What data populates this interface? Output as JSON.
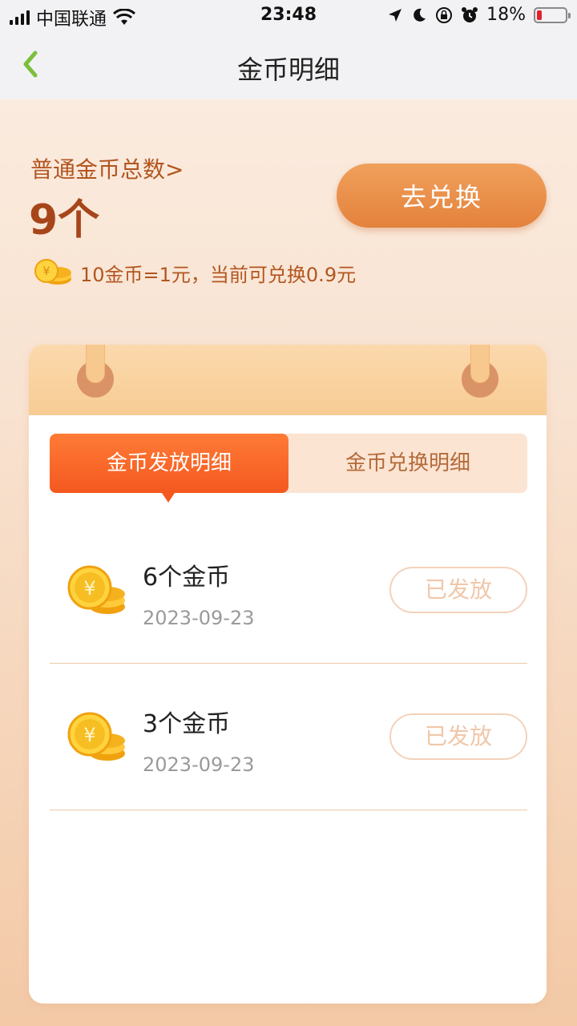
{
  "status_bar": {
    "carrier": "中国联通",
    "time": "23:48",
    "battery": "18%",
    "battery_level": 0.18
  },
  "nav": {
    "title": "金币明细"
  },
  "summary": {
    "total_label": "普通金币总数>",
    "total_value": "9个",
    "exchange_button": "去兑换",
    "rate_text": "10金币=1元，当前可兑换0.9元"
  },
  "tabs": [
    {
      "label": "金币发放明细",
      "active": true
    },
    {
      "label": "金币兑换明细",
      "active": false
    }
  ],
  "records": [
    {
      "title": "6个金币",
      "date": "2023-09-23",
      "status": "已发放"
    },
    {
      "title": "3个金币",
      "date": "2023-09-23",
      "status": "已发放"
    }
  ],
  "colors": {
    "accent": "#f4581f",
    "brand_text": "#b3551f",
    "button": "#e4823c"
  }
}
